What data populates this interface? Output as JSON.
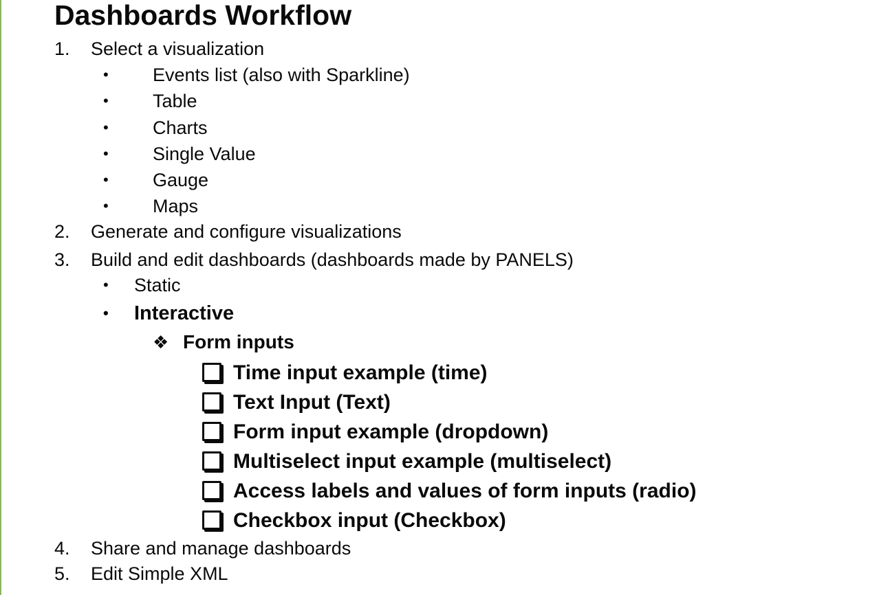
{
  "slide": {
    "title": "Dashboards Workflow",
    "steps": [
      {
        "number": "1.",
        "text": "Select a visualization",
        "bullets": [
          "Events list (also with Sparkline)",
          "Table",
          "Charts",
          "Single Value",
          "Gauge",
          "Maps"
        ]
      },
      {
        "number": "2.",
        "text": "Generate and configure visualizations"
      },
      {
        "number": "3.",
        "text": "Build and edit dashboards (dashboards made by PANELS)",
        "bullets": [
          "Static",
          "Interactive"
        ],
        "form_inputs": {
          "symbol": "❖",
          "label": "Form inputs",
          "items": [
            "Time input example (time)",
            "Text Input (Text)",
            "Form input example (dropdown)",
            "Multiselect input example (multiselect)",
            "Access labels and values of form inputs (radio)",
            "Checkbox input (Checkbox)"
          ]
        }
      },
      {
        "number": "4.",
        "text": "Share and manage dashboards"
      },
      {
        "number": "5.",
        "text": "Edit Simple XML"
      }
    ],
    "bullet_symbol": "•",
    "accent_color": "#7fc241"
  }
}
